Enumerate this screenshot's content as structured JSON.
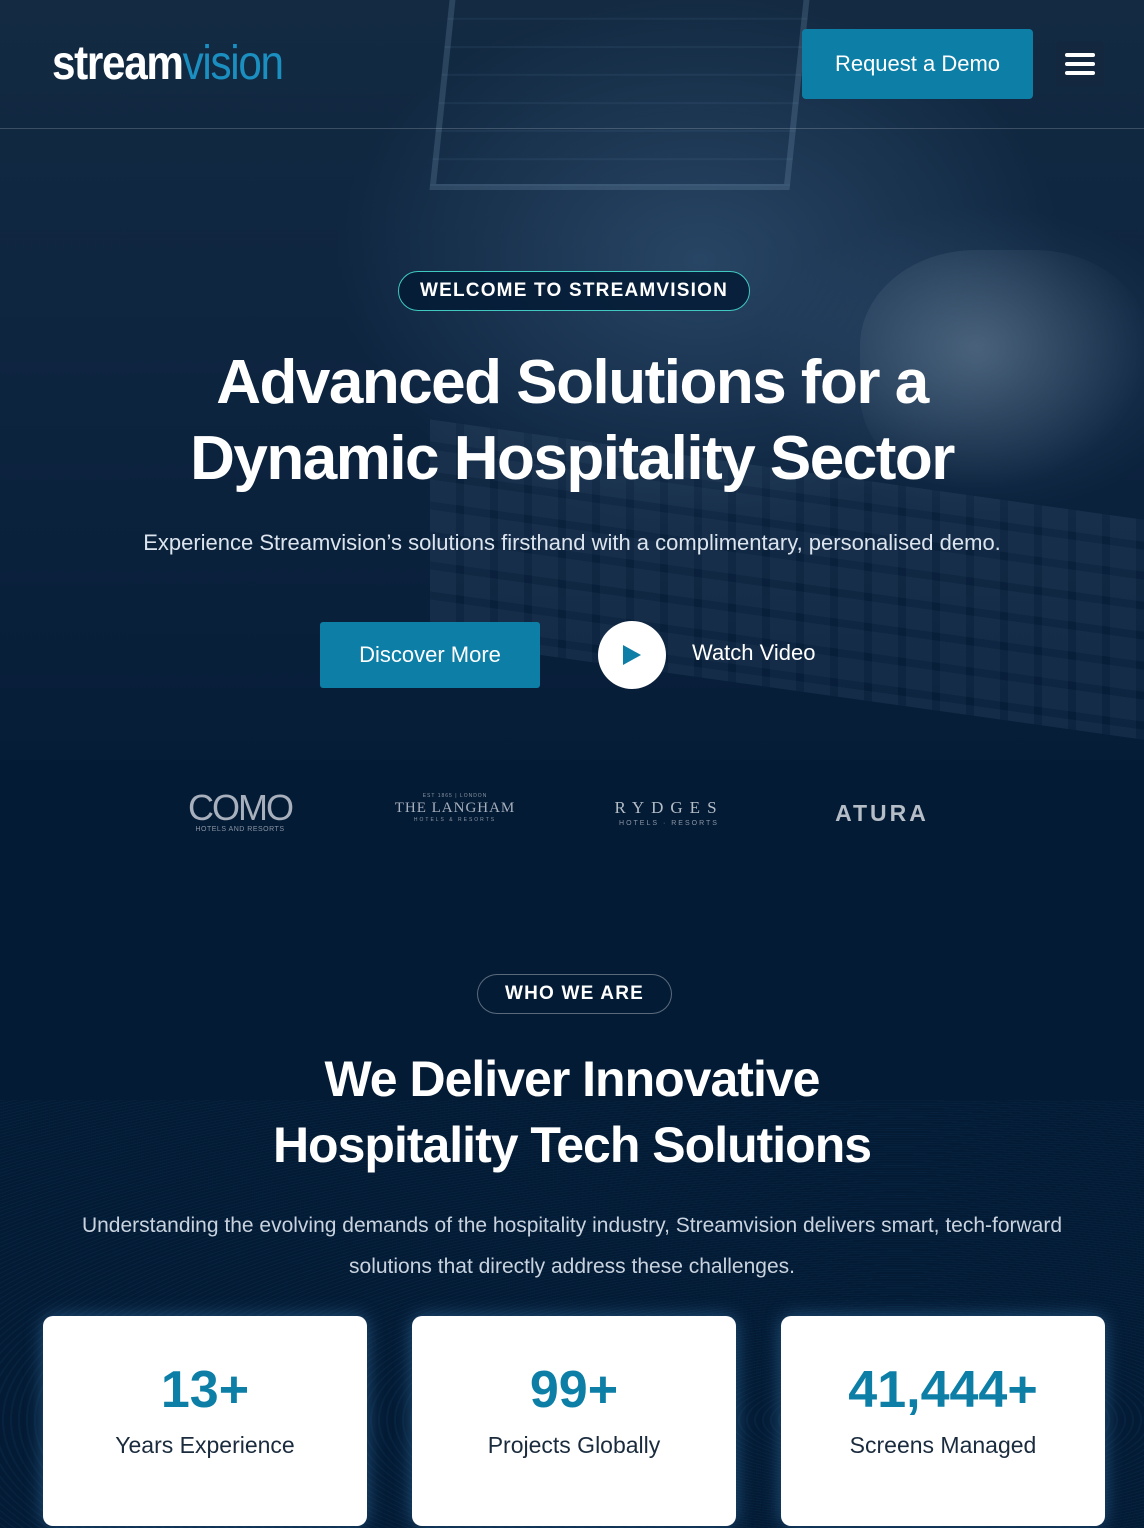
{
  "header": {
    "logo_part1": "stream",
    "logo_part2": "vision",
    "demo_button": "Request a Demo",
    "menu_icon": "hamburger-menu-icon"
  },
  "hero": {
    "eyebrow": "WELCOME TO STREAMVISION",
    "title_line1": "Advanced Solutions for a",
    "title_line2": "Dynamic Hospitality Sector",
    "subtitle": "Experience Streamvision’s solutions firsthand with a complimentary, personalised demo.",
    "primary_button": "Discover More",
    "video_label": "Watch Video",
    "play_icon": "play-icon"
  },
  "brands": [
    {
      "name": "COMO",
      "tagline": "HOTELS AND RESORTS"
    },
    {
      "pre": "EST 1865 | LONDON",
      "name": "THE LANGHAM",
      "tagline": "HOTELS & RESORTS"
    },
    {
      "name": "RYDGES",
      "tagline": "HOTELS · RESORTS"
    },
    {
      "name": "ATURA"
    }
  ],
  "about": {
    "eyebrow": "WHO WE ARE",
    "title_line1": "We Deliver Innovative",
    "title_line2": "Hospitality Tech Solutions",
    "paragraph": "Understanding the evolving demands of the hospitality industry, Streamvision delivers smart, tech-forward solutions that directly address these challenges."
  },
  "stats": [
    {
      "value": "13+",
      "label": "Years Experience"
    },
    {
      "value": "99+",
      "label": "Projects Globally"
    },
    {
      "value": "41,444+",
      "label": "Screens Managed"
    }
  ],
  "colors": {
    "accent": "#0d7fa7",
    "background": "#041b35",
    "pill_border": "#3fc9c0"
  }
}
